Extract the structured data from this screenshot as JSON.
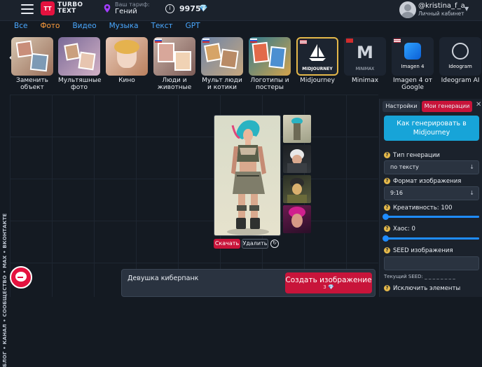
{
  "header": {
    "logo_badge": "TT",
    "logo_line1": "TURBO",
    "logo_line2": "TEXT",
    "plan_label": "Ваш тариф:",
    "plan_value": "Гений",
    "balance": "9975",
    "username": "@kristina_f_a",
    "cabinet": "Личный кабинет"
  },
  "tabs": [
    "Все",
    "Фото",
    "Видео",
    "Музыка",
    "Текст",
    "GPT"
  ],
  "active_tab": "Фото",
  "carousel": [
    {
      "label": "Заменить объект"
    },
    {
      "label": "Мультяшные фото"
    },
    {
      "label": "Кино"
    },
    {
      "label": "Люди и животные"
    },
    {
      "label": "Мульт люди и котики"
    },
    {
      "label": "Логотипы и постеры"
    },
    {
      "label": "Midjourney",
      "thumb_text": "MIDJOURNEY"
    },
    {
      "label": "Minimax",
      "thumb_text": "MINIMAX"
    },
    {
      "label": "Imagen 4 от Google",
      "thumb_text": "Imagen 4"
    },
    {
      "label": "Ideogram AI",
      "thumb_text": "Ideogram"
    }
  ],
  "vertical_links": "БЛОГ • КАНАЛ • СООБЩЕСТВО • MAX • ВКОНТАКТЕ",
  "image_actions": {
    "download": "Скачать",
    "delete": "Удалить"
  },
  "prompt": {
    "text": "Девушка киберпанк",
    "generate_label": "Создать изображение",
    "cost": "3"
  },
  "panel": {
    "tab_settings": "Настройки",
    "tab_my": "Мои генерации",
    "generate_button": "Как генерировать в Midjourney",
    "gen_type_label": "Тип генерации",
    "gen_type_value": "по тексту",
    "format_label": "Формат изображения",
    "format_value": "9:16",
    "creativity_label": "Креативность:",
    "creativity_value": "100",
    "chaos_label": "Хаос:",
    "chaos_value": "0",
    "seed_label": "SEED изображения",
    "seed_current": "Текущий SEED: _ _ _ _ _ _ _ _",
    "exclude_label": "Исключить элементы"
  },
  "colors": {
    "accent_red": "#c8143a",
    "accent_blue": "#17a4d8",
    "tab_link": "#4aa8ff",
    "tab_active": "#ff9d3c"
  }
}
